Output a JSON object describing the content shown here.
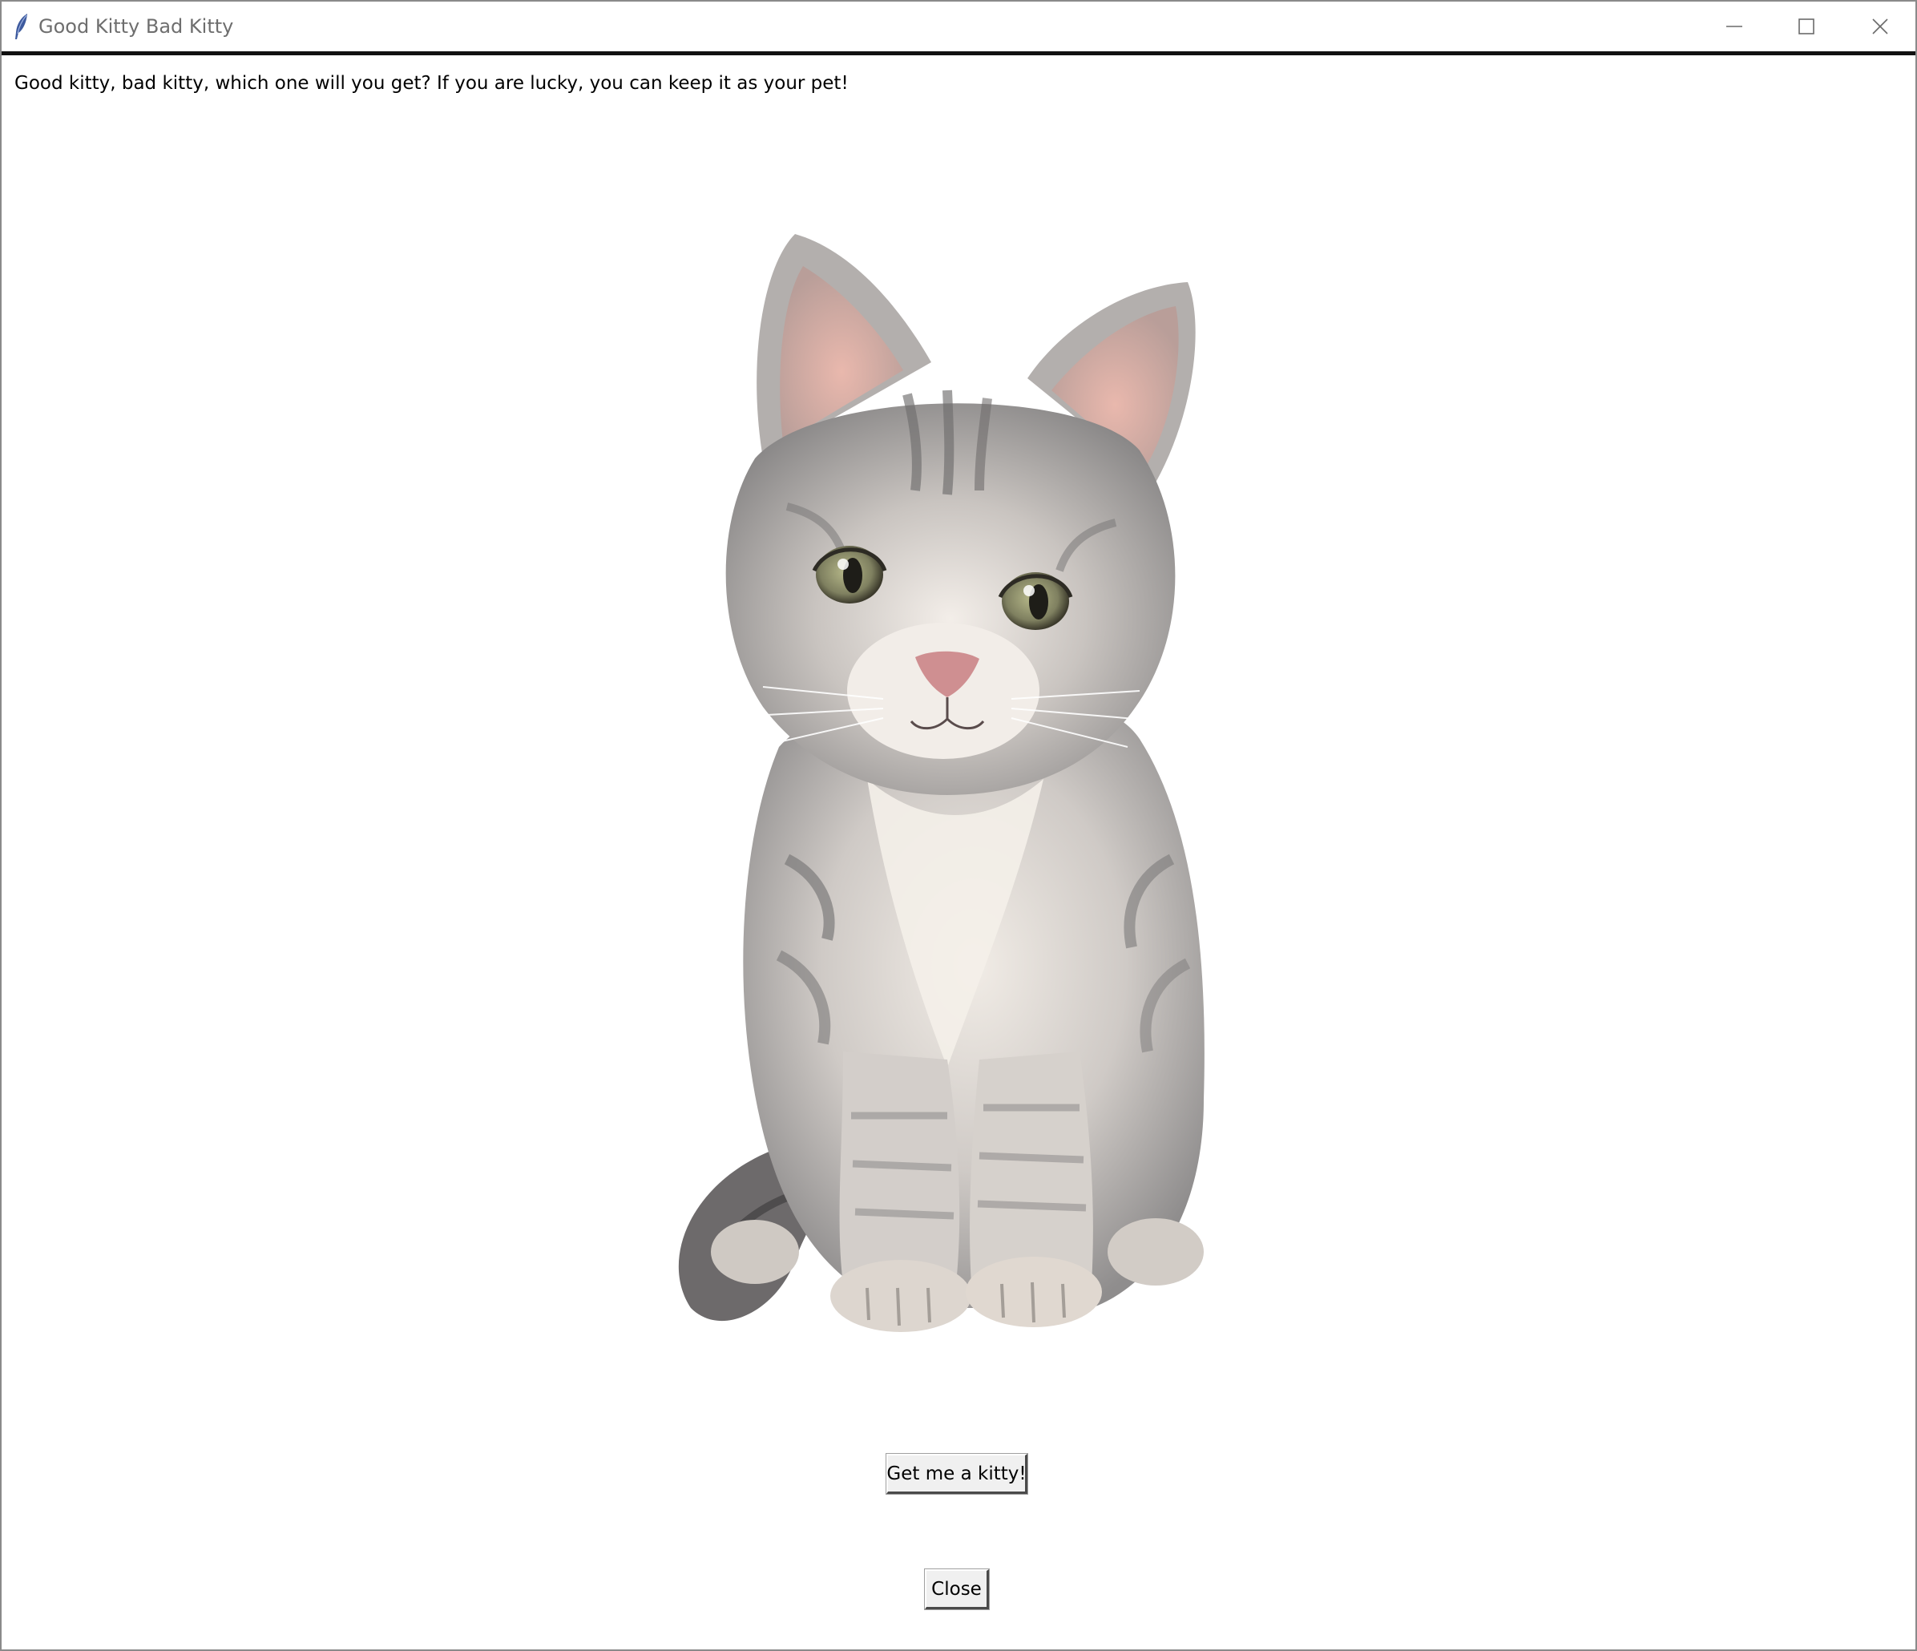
{
  "window": {
    "title": "Good Kitty Bad Kitty",
    "app_icon": "tk-feather-icon",
    "controls": {
      "minimize_icon": "minimize-icon",
      "maximize_icon": "maximize-icon",
      "close_icon": "close-icon"
    }
  },
  "main": {
    "intro_text": "Good kitty, bad kitty, which one will you get? If you are lucky, you can keep it as your pet!",
    "image": "kitten-photo",
    "get_kitty_label": "Get me a kitty!",
    "close_label": "Close"
  },
  "colors": {
    "window_bg": "#ffffff",
    "button_bg": "#f0f0f0",
    "title_text": "#6e6e6e"
  }
}
